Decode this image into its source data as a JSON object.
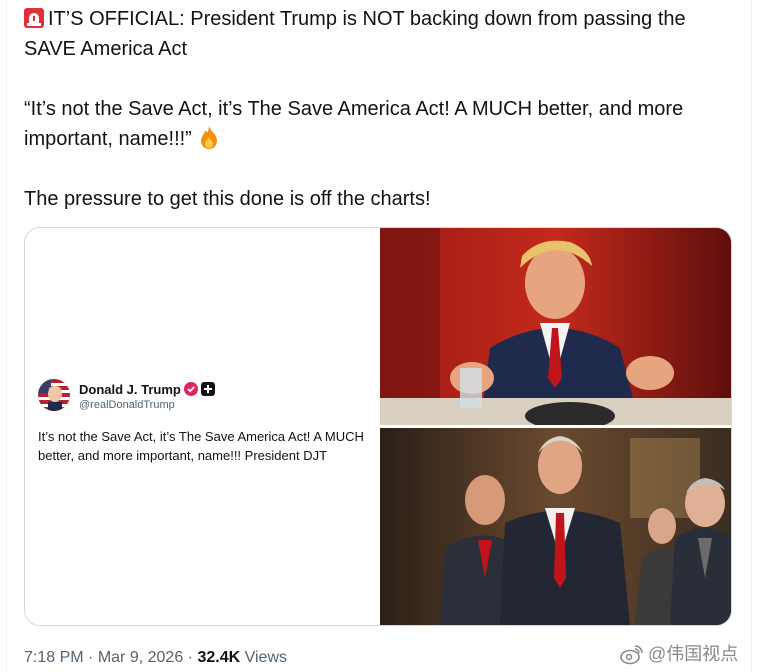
{
  "tweet": {
    "line1": "IT’S OFFICIAL: President Trump is NOT backing down from passing the SAVE America Act",
    "line2": "“It’s not the Save Act, it’s The Save America Act! A MUCH better, and more important, name!!!”",
    "line3": "The pressure to get this done is off the charts!",
    "emoji_start": "rotating-light-emoji",
    "emoji_end": "fire-emoji"
  },
  "quote": {
    "name": "Donald J. Trump",
    "handle": "@realDonaldTrump",
    "text": "It’s not the Save Act, it’s The Save America Act! A MUCH better, and more important, name!!! President DJT"
  },
  "meta": {
    "time": "7:18 PM",
    "separator": "·",
    "date": "Mar 9, 2026",
    "views_count": "32.4K",
    "views_label": "Views"
  },
  "watermark": {
    "text": "@伟国视点"
  },
  "colors": {
    "text": "#0f1419",
    "secondary": "#536471",
    "border": "#cfd9de",
    "verified_pink": "#e0245e"
  }
}
